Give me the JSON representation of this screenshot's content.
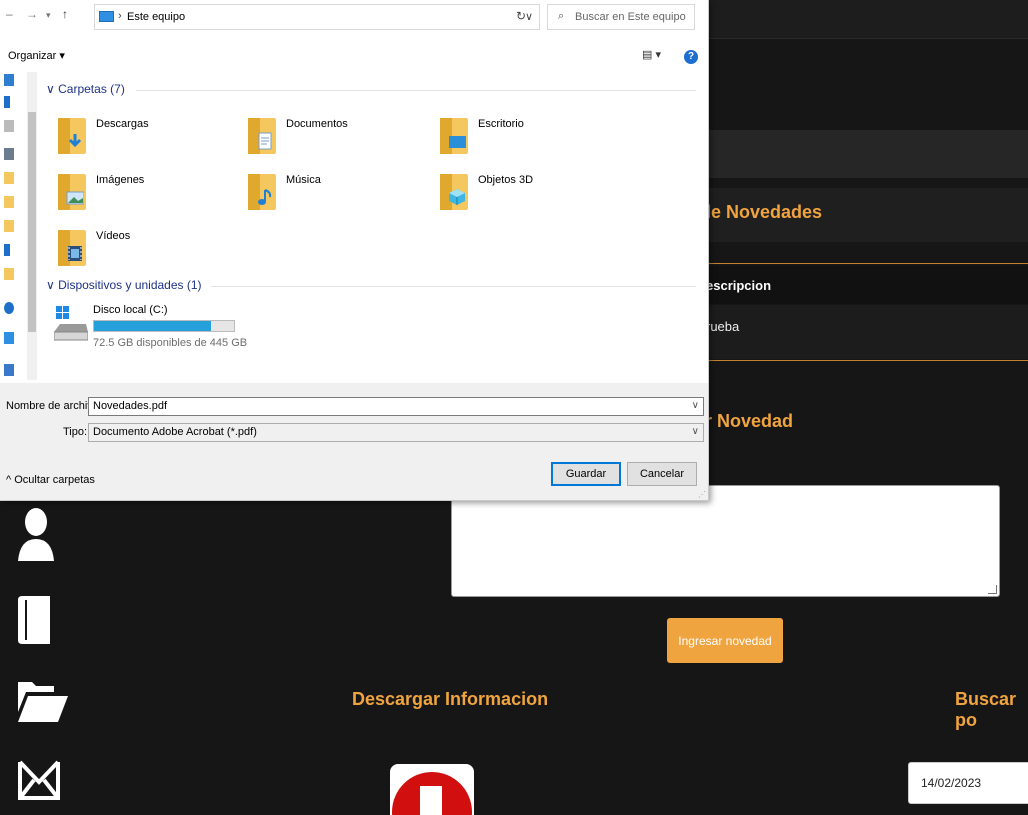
{
  "dialog": {
    "address": {
      "location": "Este equipo"
    },
    "search": {
      "placeholder": "Buscar en Este equipo"
    },
    "toolbar": {
      "organize_label": "Organizar ▾"
    },
    "groups": {
      "folders": {
        "label": "Carpetas (7)",
        "items": [
          "Descargas",
          "Documentos",
          "Escritorio",
          "Imágenes",
          "Música",
          "Objetos 3D",
          "Vídeos"
        ]
      },
      "devices": {
        "label": "Dispositivos y unidades (1)",
        "drive": {
          "name": "Disco local (C:)",
          "free_text": "72.5 GB disponibles de 445 GB",
          "used_fraction": 0.837
        }
      }
    },
    "filename": {
      "label": "Nombre de archivo:",
      "value": "Novedades.pdf"
    },
    "filetype": {
      "label": "Tipo:",
      "value": "Documento Adobe Acrobat (*.pdf)"
    },
    "hide_folders_label": "Ocultar carpetas",
    "save_label": "Guardar",
    "cancel_label": "Cancelar"
  },
  "app": {
    "novedades_title": "de Novedades",
    "table": {
      "header": "escripcion",
      "cell": "rueba"
    },
    "add_title": "ar Novedad",
    "add_button": "Ingresar novedad",
    "download_title": "Descargar Informacion",
    "search_title": "Buscar po",
    "date_value": "14/02/2023"
  },
  "colors": {
    "accent": "#f0a43f",
    "background": "#161616",
    "dialog_link": "#1e3287",
    "progress": "#26a0da"
  }
}
